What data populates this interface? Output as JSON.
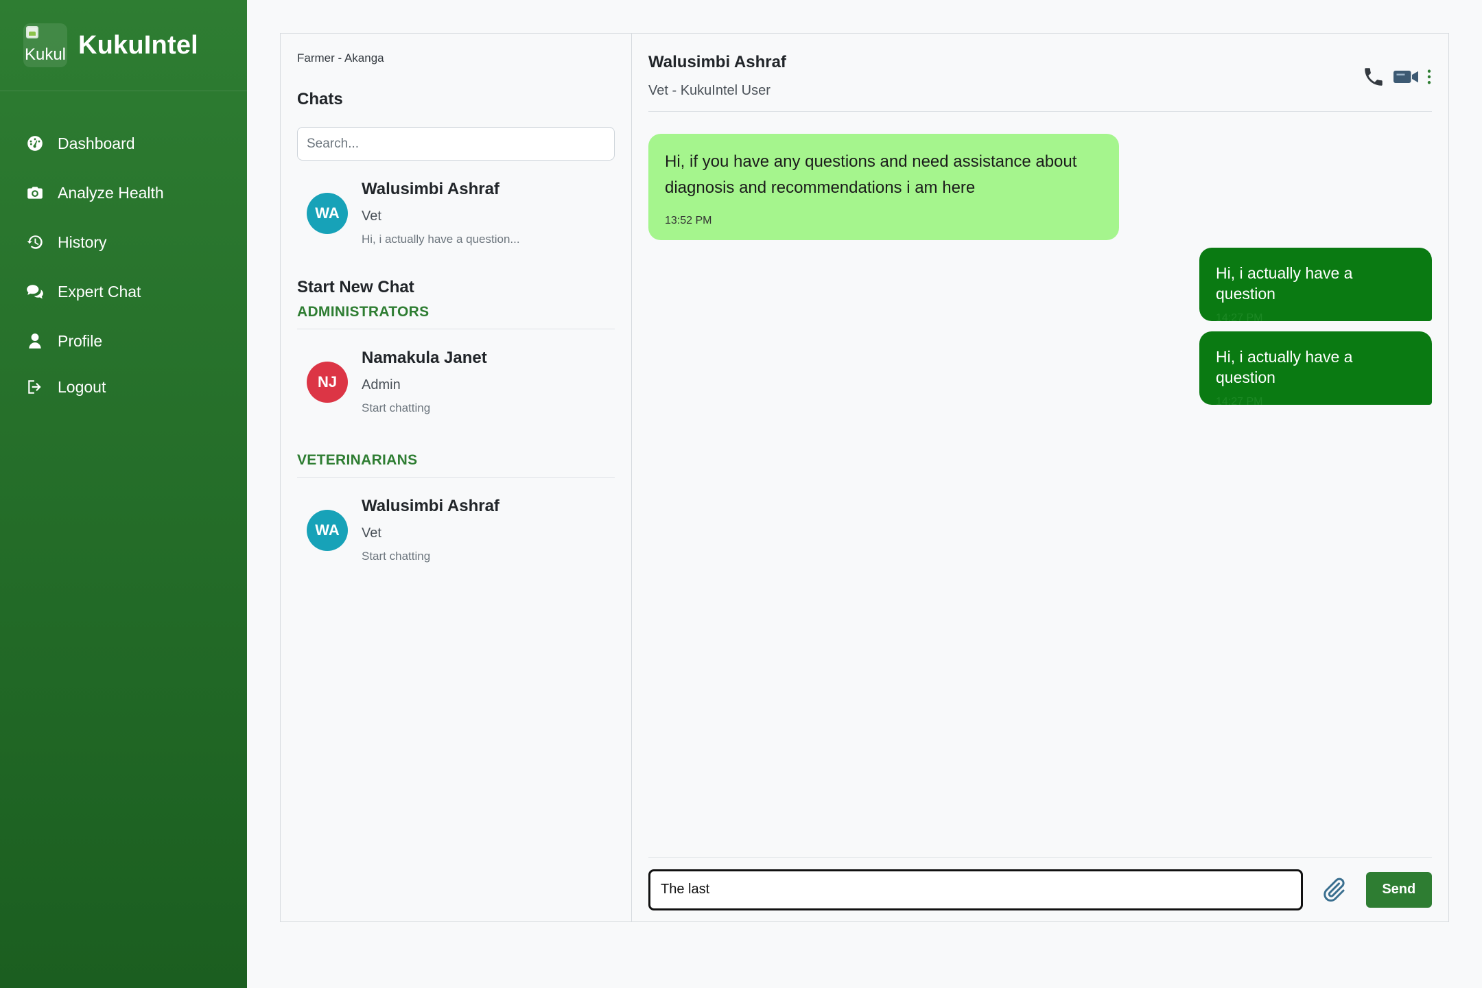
{
  "brand": {
    "logo_alt": "Kukul",
    "name": "KukuIntel"
  },
  "nav": {
    "items": [
      {
        "label": "Dashboard",
        "icon": "dashboard-icon"
      },
      {
        "label": "Analyze Health",
        "icon": "camera-icon"
      },
      {
        "label": "History",
        "icon": "history-icon"
      },
      {
        "label": "Expert Chat",
        "icon": "chat-icon"
      },
      {
        "label": "Profile",
        "icon": "user-icon"
      },
      {
        "label": "Logout",
        "icon": "logout-icon"
      }
    ]
  },
  "chat_list": {
    "current_user": "Farmer - Akanga",
    "heading": "Chats",
    "search_placeholder": "Search...",
    "conversations": [
      {
        "initials": "WA",
        "name": "Walusimbi Ashraf",
        "role": "Vet",
        "preview": "Hi, i actually have a question..."
      }
    ],
    "new_chat_title": "Start New Chat",
    "sections": [
      {
        "label": "ADMINISTRATORS",
        "contacts": [
          {
            "initials": "NJ",
            "name": "Namakula Janet",
            "role": "Admin",
            "preview": "Start chatting"
          }
        ]
      },
      {
        "label": "VETERINARIANS",
        "contacts": [
          {
            "initials": "WA",
            "name": "Walusimbi Ashraf",
            "role": "Vet",
            "preview": "Start chatting"
          }
        ]
      }
    ]
  },
  "conversation": {
    "name": "Walusimbi Ashraf",
    "subtitle": "Vet - KukuIntel User",
    "messages": [
      {
        "direction": "received",
        "text": "Hi, if you have any questions and need assistance about diagnosis and recommendations i am here",
        "time": "13:52 PM"
      },
      {
        "direction": "sent",
        "text": "Hi, i actually have a question",
        "time": "14:27 PM"
      },
      {
        "direction": "sent",
        "text": "Hi, i actually have a question",
        "time": "14:27 PM"
      }
    ],
    "input_value": "The last",
    "send_label": "Send"
  },
  "colors": {
    "sidebar": "#2e7d32",
    "accent": "#2e7d32",
    "received_bubble": "#a5f58d",
    "sent_bubble": "#0a7a12",
    "avatar_teal": "#17a2b8",
    "avatar_red": "#dc3545"
  }
}
